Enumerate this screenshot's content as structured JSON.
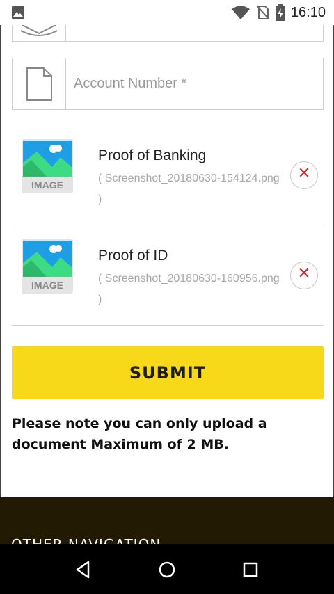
{
  "status_bar": {
    "time": "16:10"
  },
  "form": {
    "account_number": {
      "placeholder": "Account Number *",
      "value": ""
    }
  },
  "uploads": [
    {
      "title": "Proof of Banking",
      "file": "( Screenshot_20180630-154124.png",
      "file_end": ")",
      "thumb_label": "IMAGE",
      "remove_glyph": "✕"
    },
    {
      "title": "Proof of ID",
      "file": "( Screenshot_20180630-160956.png",
      "file_end": ")",
      "thumb_label": "IMAGE",
      "remove_glyph": "✕"
    }
  ],
  "submit": {
    "label": "SUBMIT"
  },
  "note": "Please note you can only upload a document Maximum of 2 MB.",
  "footer": {
    "heading": "OTHER NAVIGATION"
  },
  "colors": {
    "accent": "#f7d919",
    "footer_bg": "#231a04",
    "remove": "#d0262b"
  }
}
